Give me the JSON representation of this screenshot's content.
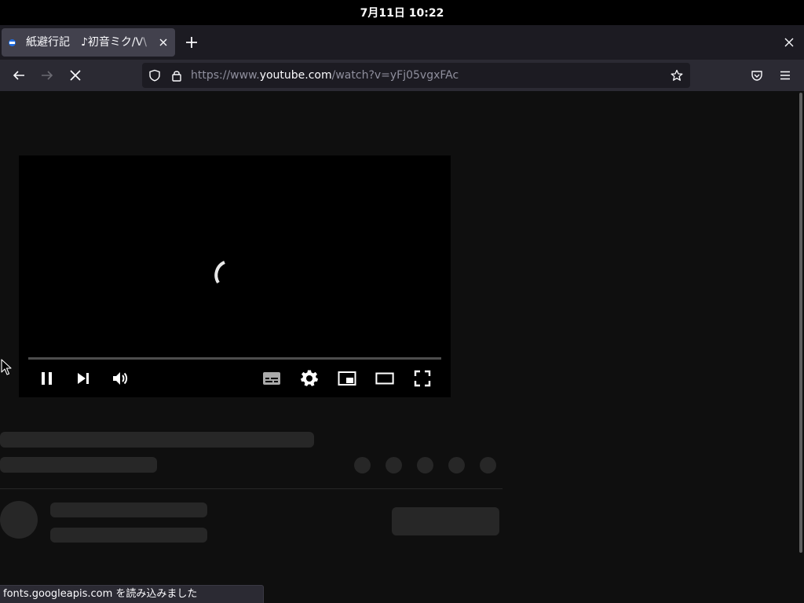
{
  "system_bar": {
    "clock": "7月11日  10:22"
  },
  "browser": {
    "tab": {
      "title": "紙避行記　♪初音ミク/V\\",
      "favicon": "youtube-favicon-icon",
      "close_icon": "close-icon"
    },
    "new_tab_icon": "plus-icon",
    "window_close_icon": "close-icon",
    "toolbar": {
      "back_icon": "arrow-left-icon",
      "forward_icon": "arrow-right-icon",
      "stop_icon": "stop-loading-x-icon",
      "url_prefix": "https://www.",
      "url_host": "youtube.com",
      "url_path": "/watch?v=yFj05vgxFAc",
      "tracking_protection_icon": "shield-icon",
      "lock_icon": "lock-icon",
      "bookmark_icon": "star-icon",
      "pocket_icon": "pocket-icon",
      "menu_icon": "hamburger-menu-icon"
    },
    "status_text": "fonts.googleapis.com を読み込みました"
  },
  "player": {
    "state": "loading",
    "loading_icon": "loading-spinner-icon",
    "controls_left": [
      "pause-icon",
      "next-icon",
      "volume-icon"
    ],
    "controls_right": [
      "subtitles-icon",
      "settings-gear-icon",
      "miniplayer-icon",
      "theater-mode-icon",
      "fullscreen-icon"
    ]
  },
  "colors": {
    "page_background": "#0f0f0f",
    "skeleton": "#272727",
    "toolbar": "#2b2a33",
    "tabstrip": "#1c1b22"
  }
}
